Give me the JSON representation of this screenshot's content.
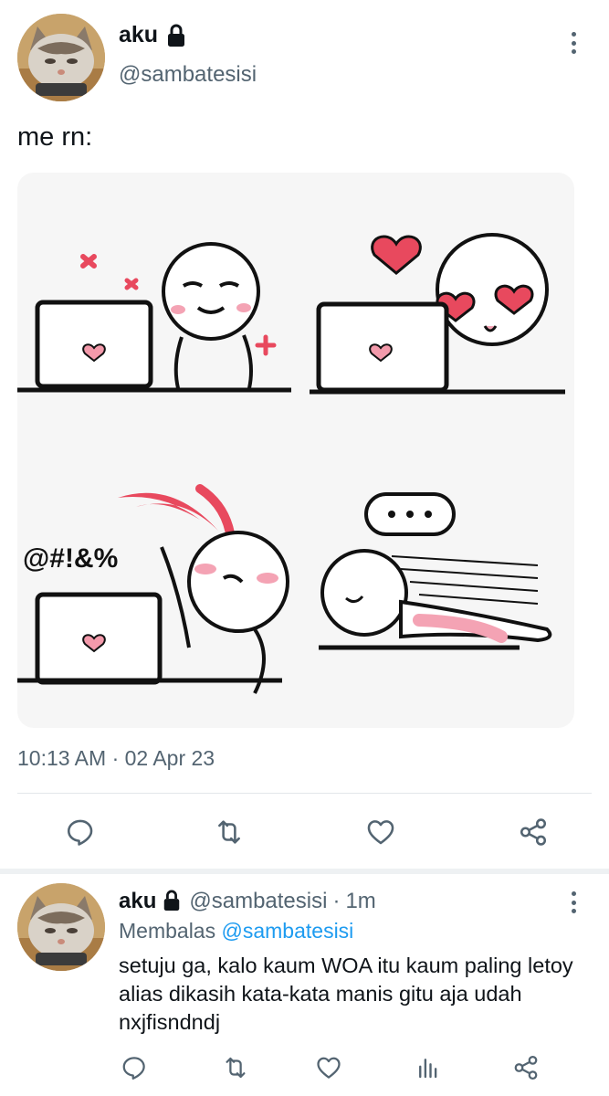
{
  "tweet": {
    "display_name": "aku",
    "handle": "@sambatesisi",
    "text": "me rn:",
    "timestamp": "10:13 AM · 02 Apr 23",
    "media_text": "@#!&%"
  },
  "reply": {
    "display_name": "aku",
    "handle": "@sambatesisi",
    "separator": "·",
    "age": "1m",
    "replying_label": "Membalas",
    "replying_to": "@sambatesisi",
    "text": "setuju ga, kalo kaum WOA itu kaum paling letoy alias dikasih kata-kata manis gitu aja udah nxjfisndndj"
  },
  "icons": {
    "main_actions": [
      "reply-icon",
      "retweet-icon",
      "like-icon",
      "share-icon"
    ],
    "reply_actions": [
      "reply-icon",
      "retweet-icon",
      "like-icon",
      "analytics-icon",
      "share-icon"
    ]
  },
  "colors": {
    "text": "#0f1419",
    "muted": "#536471",
    "link": "#1d9bf0",
    "heart": "#e8495e",
    "blush": "#f4a3b4"
  }
}
